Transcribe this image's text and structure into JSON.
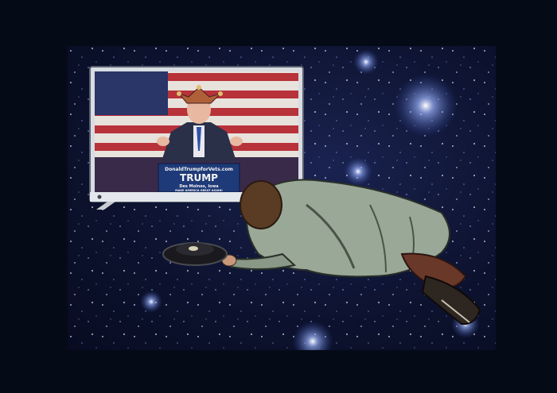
{
  "image": {
    "background_color": "#050a17",
    "space_color": "#0d1330"
  },
  "tv": {
    "podium_url": "DonaldTrumpforVets.com",
    "podium_name": "TRUMP",
    "podium_location": "Des Moines, Iowa",
    "podium_slogan": "MAKE AMERICA GREAT AGAIN!"
  },
  "colors": {
    "podium_blue": "#1e3a78",
    "flag_red": "#b8323a",
    "flag_white": "#e8e2dc",
    "coat": "#9aa898",
    "hair": "#5a3b24"
  }
}
